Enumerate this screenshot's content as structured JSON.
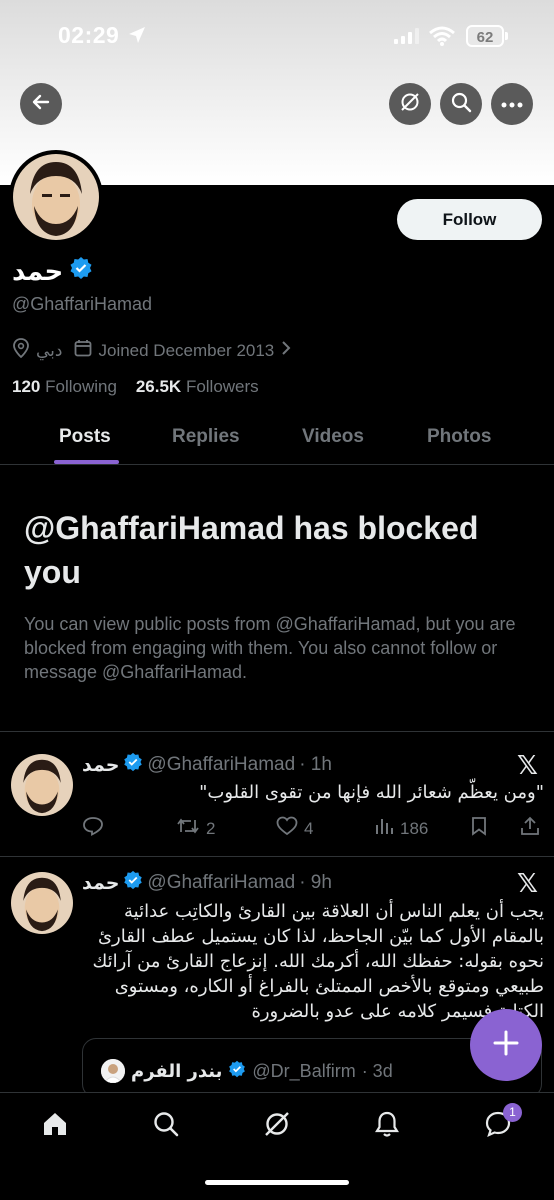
{
  "status_bar": {
    "time": "02:29",
    "battery": "62"
  },
  "profile": {
    "name": "حمد",
    "handle": "@GhaffariHamad",
    "location": "دبي",
    "joined": "Joined December 2013",
    "following_count": "120",
    "following_label": "Following",
    "followers_count": "26.5K",
    "followers_label": "Followers",
    "follow_label": "Follow"
  },
  "tabs": [
    {
      "label": "Posts",
      "active": true
    },
    {
      "label": "Replies",
      "active": false
    },
    {
      "label": "Videos",
      "active": false
    },
    {
      "label": "Photos",
      "active": false
    }
  ],
  "blocked": {
    "title": "@GhaffariHamad has blocked you",
    "body": "You can view public posts from @GhaffariHamad, but you are blocked from engaging with them. You also cannot follow or message @GhaffariHamad."
  },
  "posts": [
    {
      "name": "حمد",
      "handle": "@GhaffariHamad",
      "time": "· 1h",
      "text": "\"ومن يعظّم شعائر الله فإنها من تقوى القلوب\"",
      "reposts": "2",
      "likes": "4",
      "views": "186"
    },
    {
      "name": "حمد",
      "handle": "@GhaffariHamad",
      "time": "· 9h",
      "text": "يجب أن يعلم الناس أن العلاقة بين القارئ والكاتِب عدائية بالمقام الأول كما بيّن الجاحظ، لذا كان يستميل عطف القارئ نحوه بقوله: حفظك الله، أكرمك الله. إنزعاج القارئ من آرائك طبيعي ومتوقع بالأخص الممتلئ بالفراغ أو الكاره، ومستوى الكتابة فسيمر كلامه على عدو بالضرورة"
    }
  ],
  "quote": {
    "name": "بندر الفرم",
    "handle": "@Dr_Balfirm",
    "time": "· 3d"
  },
  "nav": {
    "messages_badge": "1"
  },
  "colors": {
    "accent": "#8a63d2",
    "verified": "#1d9bf0",
    "muted": "#71767b"
  }
}
